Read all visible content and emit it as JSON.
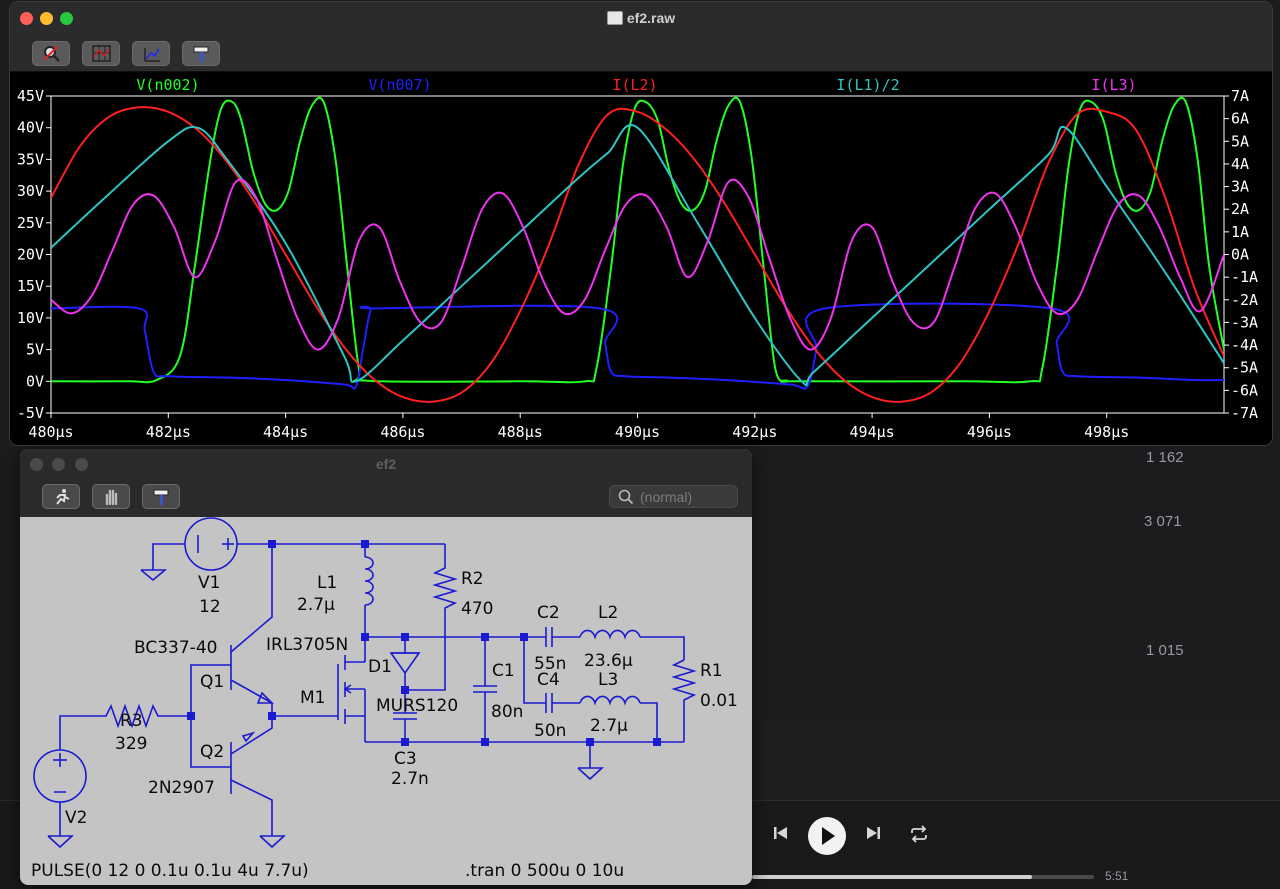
{
  "background_app": {
    "list_values": [
      "1 162",
      "3 071",
      "1 015"
    ],
    "player": {
      "previous_icon": "skip-back-icon",
      "play_icon": "play-icon",
      "next_icon": "skip-forward-icon",
      "repeat_icon": "repeat-icon",
      "progress_fraction": 0.82,
      "time": "5:51"
    }
  },
  "plot_window": {
    "title": "ef2.raw",
    "toolbar": [
      {
        "name": "autorange-button",
        "icon": "zoom-cancel-icon"
      },
      {
        "name": "grid-button",
        "icon": "grid-icon"
      },
      {
        "name": "cursor-button",
        "icon": "cursor-icon"
      },
      {
        "name": "hammer-button",
        "icon": "hammer-icon"
      }
    ],
    "colors": {
      "background": "#000000",
      "axis": "#ffffff"
    },
    "chart_data": {
      "type": "line",
      "xlabel": "",
      "ylabel": "",
      "x_unit": "µs",
      "xlim": [
        480,
        500
      ],
      "ylim_left": [
        -5,
        45
      ],
      "ylim_right": [
        -7,
        7
      ],
      "x_ticks": [
        "480µs",
        "482µs",
        "484µs",
        "486µs",
        "488µs",
        "490µs",
        "492µs",
        "494µs",
        "496µs",
        "498µs"
      ],
      "y_ticks_left": [
        "45V",
        "40V",
        "35V",
        "30V",
        "25V",
        "20V",
        "15V",
        "10V",
        "5V",
        "0V",
        "-5V"
      ],
      "y_ticks_right": [
        "7A",
        "6A",
        "5A",
        "4A",
        "3A",
        "2A",
        "1A",
        "0A",
        "-1A",
        "-2A",
        "-3A",
        "-4A",
        "-5A",
        "-6A",
        "-7A"
      ],
      "grid": false,
      "legend": "top",
      "series": [
        {
          "name": "V(n002)",
          "color": "#22ff22",
          "axis": "left",
          "x": [
            480,
            481.3,
            481.8,
            482.2,
            482.45,
            482.7,
            482.9,
            483.1,
            483.25,
            483.45,
            483.65,
            483.85,
            484.05,
            484.25,
            484.45,
            484.65,
            484.85,
            485.05,
            485.25,
            485.4,
            488,
            489.1,
            489.3,
            489.55,
            489.75,
            489.95,
            490.15,
            490.35,
            490.55,
            490.75,
            490.95,
            491.15,
            491.35,
            491.55,
            491.75,
            491.95,
            492.15,
            492.35,
            492.55,
            492.7,
            495.5,
            496.7,
            496.9,
            497.15,
            497.35,
            497.55,
            497.75,
            497.95,
            498.15,
            498.35,
            498.55,
            498.75,
            498.95,
            499.15,
            499.35,
            499.55,
            499.75,
            500
          ],
          "values": [
            0,
            0,
            0.2,
            4,
            18,
            34,
            43,
            44,
            41,
            33,
            28,
            27,
            30,
            38,
            43.5,
            44,
            35,
            18,
            2,
            0.1,
            0,
            0,
            2,
            18,
            34,
            43,
            44,
            41,
            33,
            28,
            27,
            30,
            38,
            43.5,
            44,
            35,
            18,
            2,
            0.1,
            0,
            0,
            0,
            2,
            18,
            34,
            43,
            44,
            41,
            33,
            28,
            27,
            30,
            38,
            43.5,
            44,
            35,
            18,
            5
          ]
        },
        {
          "name": "V(n007)",
          "color": "#1f1fff",
          "axis": "left",
          "x": [
            480,
            481.5,
            481.6,
            481.75,
            482,
            483,
            484,
            485,
            485.2,
            485.32,
            485.45,
            485.6,
            489.35,
            489.45,
            489.55,
            489.8,
            490.5,
            491.5,
            492.6,
            492.9,
            493.05,
            493.2,
            497.05,
            497.15,
            497.25,
            497.5,
            498.5,
            499.5,
            500
          ],
          "values": [
            11.5,
            11.5,
            8,
            1.5,
            0.8,
            0.6,
            0.2,
            -0.5,
            -0.8,
            5,
            11.2,
            11.5,
            11.5,
            6,
            1.5,
            0.8,
            0.6,
            0.2,
            -0.5,
            -0.8,
            5,
            11.5,
            11.5,
            6,
            1.5,
            0.8,
            0.6,
            0.2,
            0.2
          ]
        },
        {
          "name": "I(L2)",
          "color": "#ff2020",
          "axis": "right",
          "x": [
            480,
            480.5,
            481,
            481.5,
            482,
            482.5,
            483,
            483.5,
            484,
            484.5,
            485,
            485.5,
            486,
            486.5,
            487,
            487.5,
            488,
            488.5,
            489,
            489.5,
            490,
            490.5,
            491,
            491.5,
            492,
            492.5,
            493,
            493.5,
            494,
            494.5,
            495,
            495.5,
            496,
            496.5,
            497,
            497.5,
            498,
            498.5,
            499,
            499.5,
            500
          ],
          "values": [
            2.5,
            4.8,
            6.1,
            6.5,
            6.3,
            5.5,
            4.1,
            2.2,
            0,
            -2.2,
            -4.1,
            -5.5,
            -6.3,
            -6.5,
            -6.1,
            -4.8,
            -2.5,
            0.5,
            4.0,
            6.2,
            6.3,
            5.5,
            4.1,
            2.2,
            0,
            -2.2,
            -4.1,
            -5.5,
            -6.3,
            -6.5,
            -6.1,
            -4.8,
            -2.5,
            0.5,
            4.0,
            6.2,
            6.3,
            5.5,
            2.5,
            -1.5,
            -4.5
          ]
        },
        {
          "name": "I(L1)/2",
          "color": "#2ec4c4",
          "axis": "right",
          "x": [
            480,
            481,
            482,
            482.5,
            483,
            484,
            485,
            485.2,
            486,
            487,
            488,
            489,
            489.5,
            490,
            491,
            492,
            492.8,
            493,
            494,
            495,
            496,
            497,
            497.3,
            498,
            499,
            500
          ],
          "values": [
            0.3,
            2.7,
            5.0,
            5.6,
            4.2,
            0.5,
            -4.5,
            -5.6,
            -3.8,
            -1.4,
            1.0,
            3.4,
            4.5,
            5.6,
            1.5,
            -2.8,
            -5.6,
            -5.2,
            -2.8,
            -0.4,
            2.0,
            4.4,
            5.6,
            3.0,
            -0.8,
            -4.8
          ]
        },
        {
          "name": "I(L3)",
          "color": "#ee33ee",
          "axis": "right",
          "x": [
            480,
            480.35,
            480.7,
            481.05,
            481.4,
            481.75,
            482.1,
            482.45,
            482.8,
            483.15,
            483.5,
            483.85,
            484.2,
            484.55,
            484.9,
            485.25,
            485.6,
            485.95,
            486.3,
            486.65,
            487,
            487.35,
            487.7,
            488.05,
            488.4,
            488.75,
            489.1,
            489.45,
            489.8,
            490.15,
            490.5,
            490.85,
            491.2,
            491.55,
            491.9,
            492.25,
            492.6,
            492.95,
            493.3,
            493.65,
            494,
            494.35,
            494.7,
            495.05,
            495.4,
            495.75,
            496.1,
            496.45,
            496.8,
            497.15,
            497.5,
            497.85,
            498.2,
            498.55,
            498.9,
            499.25,
            499.6,
            500
          ],
          "values": [
            -2,
            -2.6,
            -1.8,
            0.2,
            2.2,
            2.6,
            1.2,
            -1,
            0.6,
            3.2,
            2.5,
            -0.2,
            -2.8,
            -4.2,
            -2.8,
            0.6,
            1.2,
            -1.2,
            -3.0,
            -3.0,
            -0.6,
            2.0,
            2.7,
            1.2,
            -1.2,
            -2.6,
            -2.0,
            0.2,
            2.2,
            2.6,
            1.2,
            -1,
            0.6,
            3.2,
            2.5,
            -0.2,
            -2.8,
            -4.2,
            -2.8,
            0.6,
            1.2,
            -1.2,
            -3.0,
            -3.0,
            -0.6,
            2.0,
            2.7,
            1.2,
            -1.2,
            -2.6,
            -2.0,
            0.2,
            2.2,
            2.6,
            1.2,
            -1,
            -2.5,
            0
          ]
        }
      ]
    }
  },
  "schematic_window": {
    "title": "ef2",
    "toolbar": [
      {
        "name": "run-button",
        "icon": "run-icon"
      },
      {
        "name": "pan-button",
        "icon": "hand-icon"
      },
      {
        "name": "hammer-button",
        "icon": "hammer-icon"
      }
    ],
    "search_placeholder": "(normal)",
    "labels": {
      "v1": "V1",
      "v1_value": "12",
      "l1": "L1",
      "l1_value": "2.7µ",
      "r2": "R2",
      "r2_value": "470",
      "c2": "C2",
      "c2_value": "55n",
      "l2": "L2",
      "l2_value": "23.6µ",
      "r1": "R1",
      "r1_value": "0.01",
      "c4": "C4",
      "c4_value": "50n",
      "l3": "L3",
      "l3_value": "2.7µ",
      "c1": "C1",
      "c1_value": "80n",
      "q1_model": "BC337-40",
      "q1": "Q1",
      "m1_model": "IRL3705N",
      "m1": "M1",
      "d1": "D1",
      "d1_model": "MURS120",
      "r3": "R3",
      "r3_value": "329",
      "q2": "Q2",
      "q2_model": "2N2907",
      "c3": "C3",
      "c3_value": "2.7n",
      "v2": "V2",
      "pulse": "PULSE(0 12 0 0.1u 0.1u 4u 7.7u)",
      "tran": ".tran 0 500u 0 10u"
    }
  }
}
